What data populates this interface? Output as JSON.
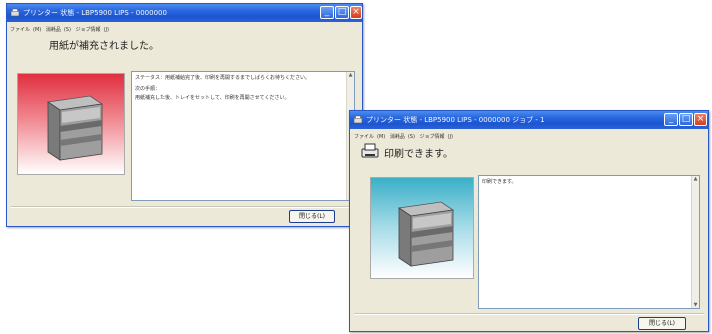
{
  "window1": {
    "title": "プリンター 状態 - LBP5900 LIPS - 0000000",
    "menu": [
      "ファイル",
      "(M)",
      "消耗品",
      "(S)",
      "ジョブ情報",
      "(J)"
    ],
    "status_message": "用紙が補充されました。",
    "detail_lines": [
      "ステータス：用紙補給完了後、印刷を再開するまでしばらくお待ちください。",
      "次の手順：",
      "用紙補充した後、トレイをセットして、印刷を再開させてください。"
    ],
    "close_button": "閉じる(L)",
    "colors": {
      "image_bg_top": "#e04050",
      "image_bg_bottom": "#ffffff"
    }
  },
  "window2": {
    "title": "プリンター 状態 - LBP5900 LIPS - 0000000 ジョブ - 1",
    "menu": [
      "ファイル",
      "(M)",
      "消耗品",
      "(S)",
      "ジョブ情報",
      "(J)"
    ],
    "status_message": "印刷できます。",
    "detail_lines": [
      "印刷できます。"
    ],
    "close_button": "閉じる(L)",
    "colors": {
      "image_bg_top": "#3aa8c0",
      "image_bg_bottom": "#ffffff"
    }
  }
}
